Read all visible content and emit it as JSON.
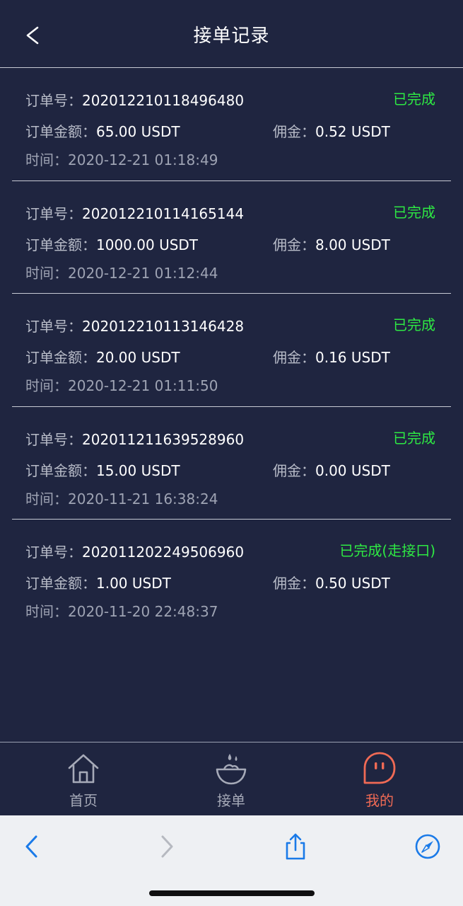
{
  "header": {
    "title": "接单记录"
  },
  "labels": {
    "order_no": "订单号：",
    "amount": "订单金额：",
    "commission": "佣金：",
    "time": "时间："
  },
  "orders": [
    {
      "order_no": "202012210118496480",
      "amount": "65.00 USDT",
      "commission": "0.52 USDT",
      "time": "2020-12-21 01:18:49",
      "status": "已完成"
    },
    {
      "order_no": "202012210114165144",
      "amount": "1000.00 USDT",
      "commission": "8.00 USDT",
      "time": "2020-12-21 01:12:44",
      "status": "已完成"
    },
    {
      "order_no": "202012210113146428",
      "amount": "20.00 USDT",
      "commission": "0.16 USDT",
      "time": "2020-12-21 01:11:50",
      "status": "已完成"
    },
    {
      "order_no": "202011211639528960",
      "amount": "15.00 USDT",
      "commission": "0.00 USDT",
      "time": "2020-11-21 16:38:24",
      "status": "已完成"
    },
    {
      "order_no": "202011202249506960",
      "amount": "1.00 USDT",
      "commission": "0.50 USDT",
      "time": "2020-11-20 22:48:37",
      "status": "已完成(走接口)"
    }
  ],
  "tabbar": {
    "items": [
      {
        "label": "首页",
        "icon": "home-icon"
      },
      {
        "label": "接单",
        "icon": "bowl-icon"
      },
      {
        "label": "我的",
        "icon": "profile-face-icon",
        "active": true
      }
    ]
  },
  "browser": {
    "icons": [
      "back-arrow-icon",
      "forward-arrow-icon",
      "share-icon",
      "compass-icon"
    ]
  },
  "colors": {
    "background": "#1f2540",
    "status_green": "#2ee843",
    "active_tab": "#f06a55",
    "browser_blue": "#1a7ae8"
  }
}
